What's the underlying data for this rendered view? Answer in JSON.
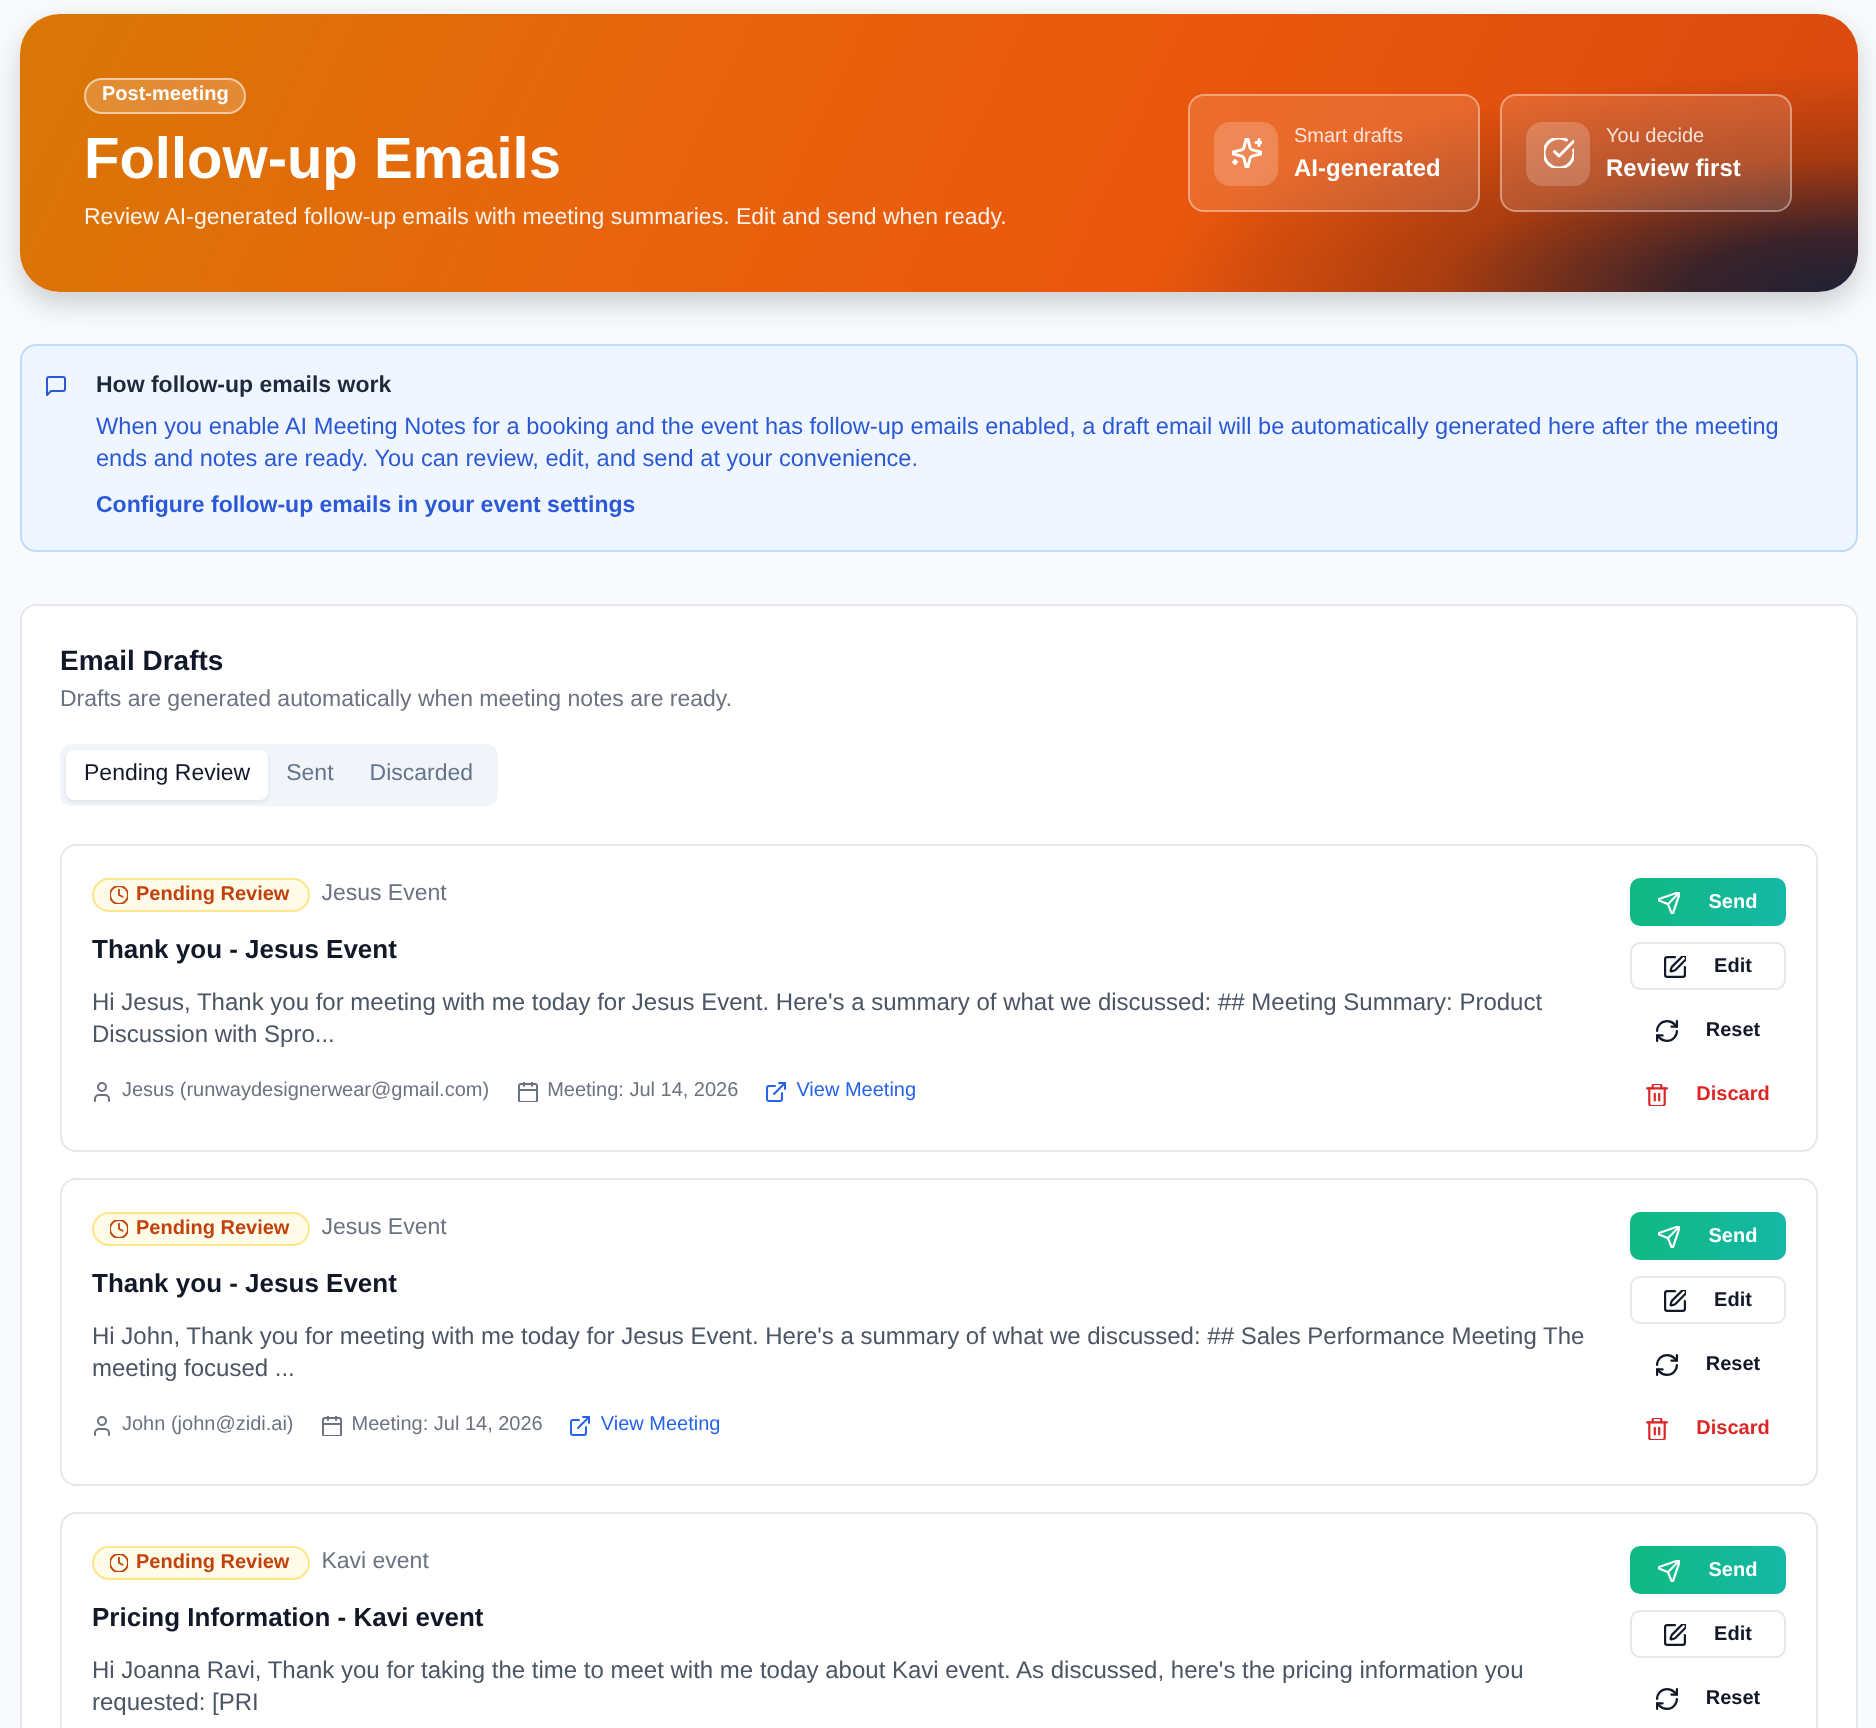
{
  "hero": {
    "badge": "Post-meeting",
    "title": "Follow-up Emails",
    "subtitle": "Review AI-generated follow-up emails with meeting summaries. Edit and send when ready.",
    "stats": [
      {
        "label": "Smart drafts",
        "value": "AI-generated"
      },
      {
        "label": "You decide",
        "value": "Review first"
      }
    ]
  },
  "info": {
    "title": "How follow-up emails work",
    "body": "When you enable AI Meeting Notes for a booking and the event has follow-up emails enabled, a draft email will be automatically generated here after the meeting ends and notes are ready. You can review, edit, and send at your convenience.",
    "link": "Configure follow-up emails in your event settings"
  },
  "drafts_panel": {
    "title": "Email Drafts",
    "subtitle": "Drafts are generated automatically when meeting notes are ready.",
    "tabs": [
      {
        "label": "Pending Review",
        "selected": true
      },
      {
        "label": "Sent",
        "selected": false
      },
      {
        "label": "Discarded",
        "selected": false
      }
    ],
    "drafts": [
      {
        "status": {
          "label": "Pending Review",
          "kind": "pending"
        },
        "event": "Jesus Event",
        "title": "Thank you - Jesus Event",
        "preview": "Hi Jesus, Thank you for meeting with me today for Jesus Event. Here's a summary of what we discussed: ## Meeting Summary: Product Discussion with Spro...",
        "recipient": "Jesus (runwaydesignerwear@gmail.com)",
        "meeting": "Meeting: Jul 14, 2026",
        "link": "View Meeting",
        "actions": [
          {
            "label": "Send",
            "kind": "primary"
          },
          {
            "label": "Edit",
            "kind": "outline"
          },
          {
            "label": "Reset",
            "kind": "plain"
          },
          {
            "label": "Discard",
            "kind": "danger"
          }
        ]
      },
      {
        "status": {
          "label": "Pending Review",
          "kind": "pending"
        },
        "event": "Jesus Event",
        "title": "Thank you - Jesus Event",
        "preview": "Hi John, Thank you for meeting with me today for Jesus Event. Here's a summary of what we discussed: ## Sales Performance Meeting The meeting focused ...",
        "recipient": "John (john@zidi.ai)",
        "meeting": "Meeting: Jul 14, 2026",
        "link": "View Meeting",
        "actions": [
          {
            "label": "Send",
            "kind": "primary"
          },
          {
            "label": "Edit",
            "kind": "outline"
          },
          {
            "label": "Reset",
            "kind": "plain"
          },
          {
            "label": "Discard",
            "kind": "danger"
          }
        ]
      },
      {
        "status": {
          "label": "Pending Review",
          "kind": "pending"
        },
        "event": "Kavi event",
        "title": "Pricing Information - Kavi event",
        "preview": "Hi Joanna Ravi, Thank you for taking the time to meet with me today about Kavi event. As discussed, here's the pricing information you requested: [PRI",
        "actions": [
          {
            "label": "Send",
            "kind": "primary"
          },
          {
            "label": "Edit",
            "kind": "outline"
          },
          {
            "label": "Reset",
            "kind": "plain"
          }
        ]
      }
    ]
  }
}
